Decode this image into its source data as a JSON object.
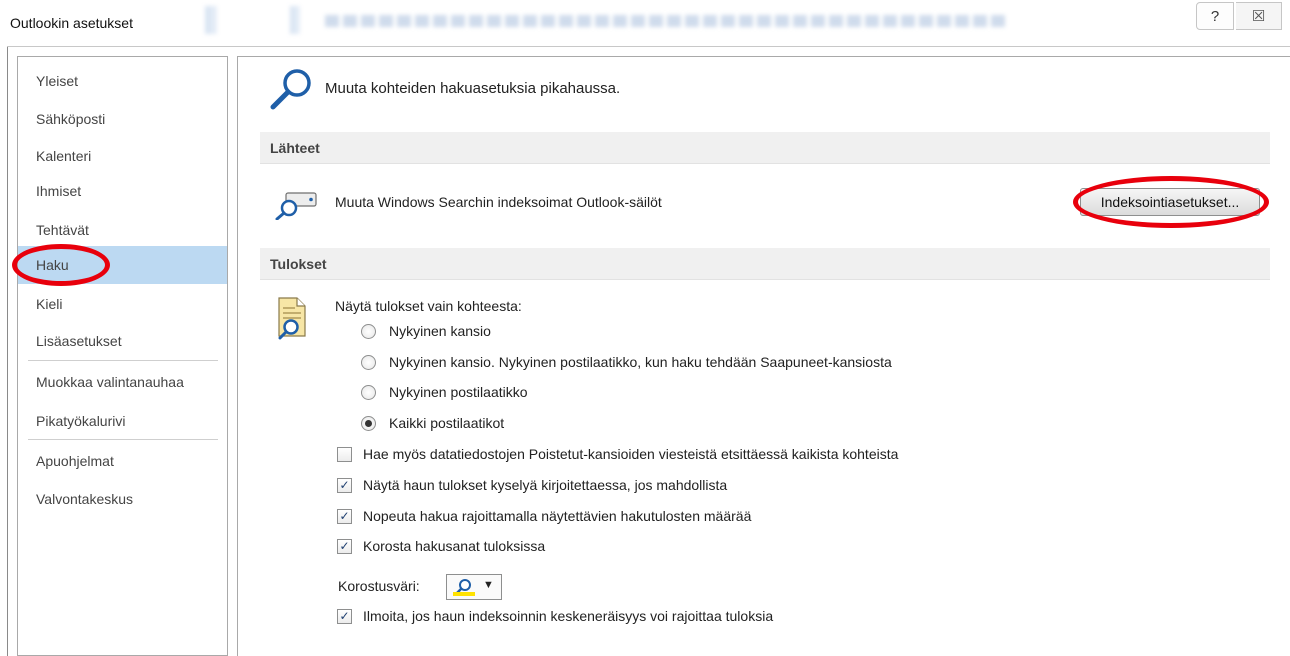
{
  "window": {
    "title": "Outlookin asetukset",
    "help_glyph": "?",
    "close_glyph": "☒"
  },
  "sidebar": {
    "items": [
      {
        "label": "Yleiset"
      },
      {
        "label": "Sähköposti"
      },
      {
        "label": "Kalenteri"
      },
      {
        "label": "Ihmiset"
      },
      {
        "label": "Tehtävät"
      },
      {
        "label": "Haku"
      },
      {
        "label": "Kieli"
      },
      {
        "label": "Lisäasetukset"
      },
      {
        "label": "Muokkaa valintanauhaa"
      },
      {
        "label": "Pikatyökalurivi"
      },
      {
        "label": "Apuohjelmat"
      },
      {
        "label": "Valvontakeskus"
      }
    ],
    "selected": "Haku"
  },
  "main": {
    "header": "Muuta kohteiden hakuasetuksia pikahaussa.",
    "sources": {
      "title": "Lähteet",
      "description": "Muuta Windows Searchin indeksoimat Outlook-säilöt",
      "button_label": "Indeksointiasetukset..."
    },
    "results": {
      "title": "Tulokset",
      "scope_label": "Näytä tulokset vain kohteesta:",
      "scope_options": [
        {
          "label": "Nykyinen kansio",
          "selected": false
        },
        {
          "label": "Nykyinen kansio. Nykyinen postilaatikko, kun haku tehdään Saapuneet-kansiosta",
          "selected": false
        },
        {
          "label": "Nykyinen postilaatikko",
          "selected": false
        },
        {
          "label": "Kaikki postilaatikot",
          "selected": true
        }
      ],
      "checkboxes": [
        {
          "label": "Hae myös datatiedostojen Poistetut-kansioiden viesteistä etsittäessä kaikista kohteista",
          "checked": false
        },
        {
          "label": "Näytä haun tulokset kyselyä kirjoitettaessa, jos mahdollista",
          "checked": true
        },
        {
          "label": "Nopeuta hakua rajoittamalla näytettävien hakutulosten määrää",
          "checked": true
        },
        {
          "label": "Korosta hakusanat tuloksissa",
          "checked": true
        }
      ],
      "highlight_color_label": "Korostusväri:",
      "highlight_color": "#ffe200",
      "last_checkbox": {
        "label": "Ilmoita, jos haun indeksoinnin keskeneräisyys voi rajoittaa tuloksia",
        "checked": true
      }
    }
  },
  "colors": {
    "selected_item_bg": "#bcd9f2",
    "annotation_ring": "#e8000c",
    "section_bg": "#f0f0f0"
  },
  "icons": {
    "header": "magnifier-icon",
    "sources": "search-drive-icon",
    "results": "document-search-icon",
    "color_picker": "highlight-magnifier-icon",
    "dropdown": "dropdown-arrow-icon"
  }
}
